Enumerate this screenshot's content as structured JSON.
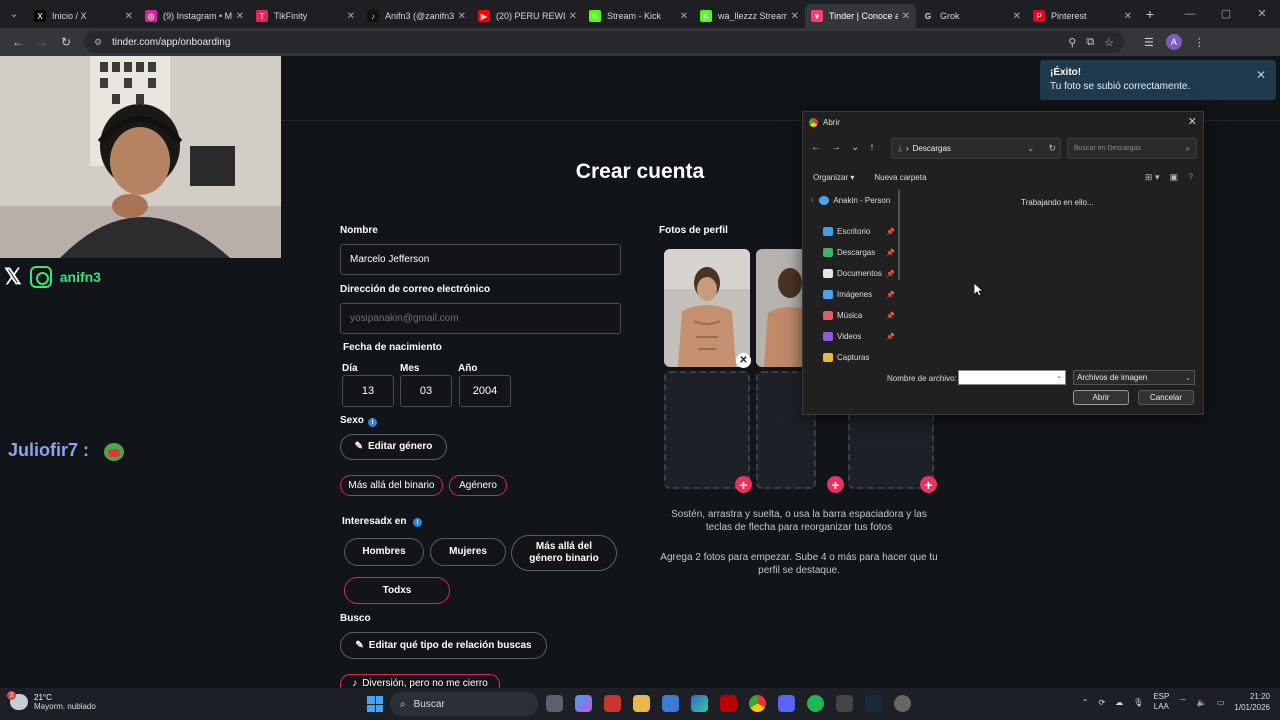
{
  "browser": {
    "tabs": [
      {
        "label": "Inicio / X",
        "color": "#000000",
        "glyph": "X"
      },
      {
        "label": "(9) Instagram • M",
        "color": "#d6249f",
        "glyph": "◎"
      },
      {
        "label": "TikFinity",
        "color": "#e0245e",
        "glyph": "T"
      },
      {
        "label": "Anifn3 (@zanifn3",
        "color": "#111111",
        "glyph": "♪"
      },
      {
        "label": "(20) PERU REWIN",
        "color": "#ff0000",
        "glyph": "▶"
      },
      {
        "label": "Stream - Kick",
        "color": "#53fc18",
        "glyph": "K"
      },
      {
        "label": "wa_llezzz Stream",
        "color": "#53fc18",
        "glyph": "K"
      },
      {
        "label": "Tinder | Conoce a",
        "color": "#fe3c72",
        "glyph": "♥"
      },
      {
        "label": "Grok",
        "color": "#222222",
        "glyph": "G"
      },
      {
        "label": "Pinterest",
        "color": "#e60023",
        "glyph": "P"
      }
    ],
    "url": "tinder.com/app/onboarding"
  },
  "overlay": {
    "social_handle": "anifn3",
    "chat_user": "Juliofir7",
    "chat_separator": ":"
  },
  "toast": {
    "title": "¡Éxito!",
    "message": "Tu foto se subió correctamente."
  },
  "form": {
    "title": "Crear cuenta",
    "name_label": "Nombre",
    "name_value": "Marcelo Jefferson",
    "email_label": "Dirección de correo electrónico",
    "email_placeholder": "yosipanakin@gmail.com",
    "birth_label": "Fecha de nacimiento",
    "day_label": "Día",
    "day_value": "13",
    "month_label": "Mes",
    "month_value": "03",
    "year_label": "Año",
    "year_value": "2004",
    "sex_label": "Sexo",
    "edit_gender": "Editar género",
    "gender_tags": [
      "Más allá del binario",
      "Agénero"
    ],
    "interest_label": "Interesadx en",
    "interest_options": [
      "Hombres",
      "Mujeres",
      "Más allá del género binario",
      "Todxs"
    ],
    "seek_label": "Busco",
    "edit_relationship": "Editar qué tipo de relación buscas",
    "relationship_value": "Diversión, pero no me cierro"
  },
  "photos": {
    "label": "Fotos de perfil",
    "help1": "Sostén, arrastra y suelta, o usa la barra espaciadora y las teclas de flecha para reorganizar tus fotos",
    "help2": "Agrega 2 fotos para empezar. Sube 4 o más para hacer que tu perfil se destaque.",
    "accent": "#e8325f"
  },
  "dialog": {
    "title": "Abrir",
    "path": "Descargas",
    "search_placeholder": "Buscar en Descargas",
    "organize": "Organizar",
    "new_folder": "Nueva carpeta",
    "tree_root": "Anakin - Person",
    "quick_access": [
      {
        "label": "Escritorio",
        "color": "#3fa0e8"
      },
      {
        "label": "Descargas",
        "color": "#3db36b"
      },
      {
        "label": "Documentos",
        "color": "#e6e6e6"
      },
      {
        "label": "Imágenes",
        "color": "#4aa3f0"
      },
      {
        "label": "Música",
        "color": "#e25d5d"
      },
      {
        "label": "Videos",
        "color": "#8c5ce0"
      },
      {
        "label": "Capturas",
        "color": "#e8b84a"
      }
    ],
    "status": "Trabajando en ello...",
    "filename_label": "Nombre de archivo:",
    "filetype": "Archivos de imagen",
    "open_button": "Abrir",
    "cancel_button": "Cancelar"
  },
  "taskbar": {
    "temp": "21°C",
    "weather": "Mayorm. nublado",
    "search": "Buscar",
    "lang1": "ESP",
    "lang2": "LAA",
    "time": "21:20",
    "date": "1/01/2026",
    "weather_badge": "3"
  }
}
